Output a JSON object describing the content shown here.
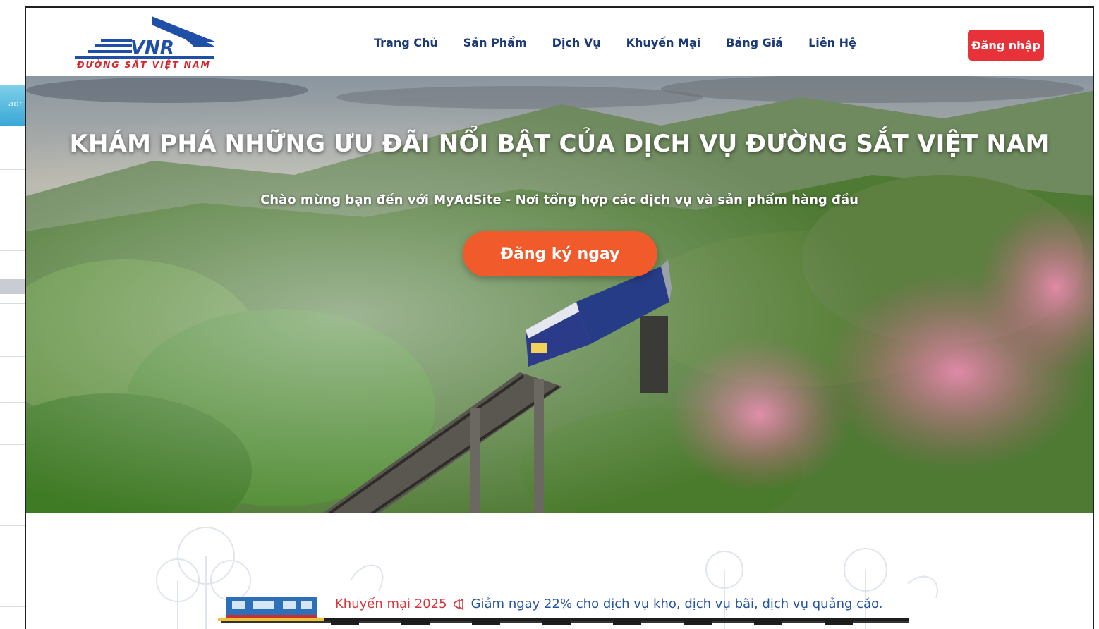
{
  "background_window": {
    "tab_text": "adr"
  },
  "header": {
    "logo_text": "VNR",
    "logo_subtitle": "ĐƯỜNG SẮT VIỆT NAM",
    "nav": [
      {
        "label": "Trang Chủ"
      },
      {
        "label": "Sản Phẩm"
      },
      {
        "label": "Dịch Vụ"
      },
      {
        "label": "Khuyến Mại"
      },
      {
        "label": "Bảng Giá"
      },
      {
        "label": "Liên Hệ"
      }
    ],
    "login_label": "Đăng nhập"
  },
  "hero": {
    "title": "KHÁM PHÁ NHỮNG ƯU ĐÃI NỔI BẬT CỦA DỊCH VỤ ĐƯỜNG SẮT VIỆT NAM",
    "subtitle": "Chào mừng bạn đến với MyAdSite - Nơi tổng hợp các dịch vụ và sản phẩm hàng đầu",
    "cta_label": "Đăng ký ngay"
  },
  "promo": {
    "label": "Khuyến mại 2025",
    "icon": "megaphone-icon",
    "message": "Giảm ngay 22% cho dịch vụ kho, dịch vụ bãi, dịch vụ quảng cáo."
  },
  "colors": {
    "nav_text": "#1c3a78",
    "login_button": "#e8323a",
    "cta_button": "#f15a2b",
    "promo_label": "#d6343b",
    "promo_message": "#2453a3",
    "logo_blue": "#1f4fa6",
    "logo_red": "#d6262c"
  }
}
